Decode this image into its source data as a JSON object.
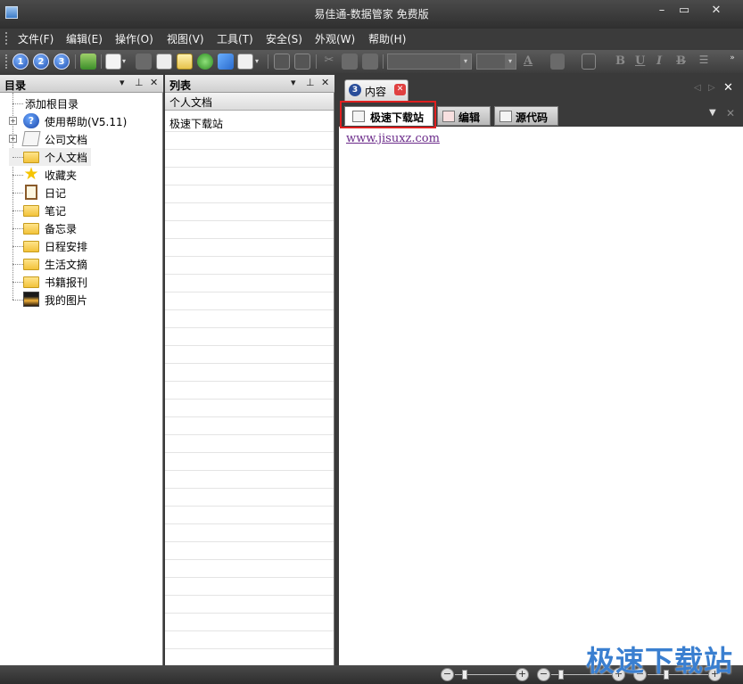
{
  "window": {
    "title": "易佳通-数据管家 免费版",
    "min": "–",
    "max": "▭",
    "close": "✕"
  },
  "menu": [
    "文件(F)",
    "编辑(E)",
    "操作(O)",
    "视图(V)",
    "工具(T)",
    "安全(S)",
    "外观(W)",
    "帮助(H)"
  ],
  "toolbar": {
    "btn1": "1",
    "btn2": "2",
    "btn3": "3",
    "bold": "B",
    "underline": "U",
    "italic": "I",
    "strike": "B",
    "fontcolor": "A"
  },
  "catalog": {
    "title": "目录",
    "items": [
      {
        "label": "添加根目录",
        "icon": "none"
      },
      {
        "label": "使用帮助(V5.11)",
        "icon": "help-icon",
        "expandable": true
      },
      {
        "label": "公司文档",
        "icon": "document-stack-icon",
        "expandable": true
      },
      {
        "label": "个人文档",
        "icon": "folder-icon",
        "selected": true
      },
      {
        "label": "收藏夹",
        "icon": "star-icon"
      },
      {
        "label": "日记",
        "icon": "clipboard-icon"
      },
      {
        "label": "笔记",
        "icon": "folder-icon"
      },
      {
        "label": "备忘录",
        "icon": "folder-icon"
      },
      {
        "label": "日程安排",
        "icon": "folder-icon"
      },
      {
        "label": "生活文摘",
        "icon": "folder-icon"
      },
      {
        "label": "书籍报刊",
        "icon": "folder-icon"
      },
      {
        "label": "我的图片",
        "icon": "picture-icon"
      }
    ]
  },
  "list": {
    "title": "列表",
    "header": "个人文档",
    "rows": [
      "极速下载站"
    ]
  },
  "content": {
    "tab_main": "内容",
    "tab_main_num": "3",
    "subtabs": [
      "极速下载站",
      "编辑",
      "源代码"
    ],
    "link": "www.jisuxz.com"
  },
  "watermark": "极速下载站",
  "colors": {
    "chrome": "#3a3a3a",
    "highlight": "#e02020",
    "link": "#6b2b8a"
  }
}
